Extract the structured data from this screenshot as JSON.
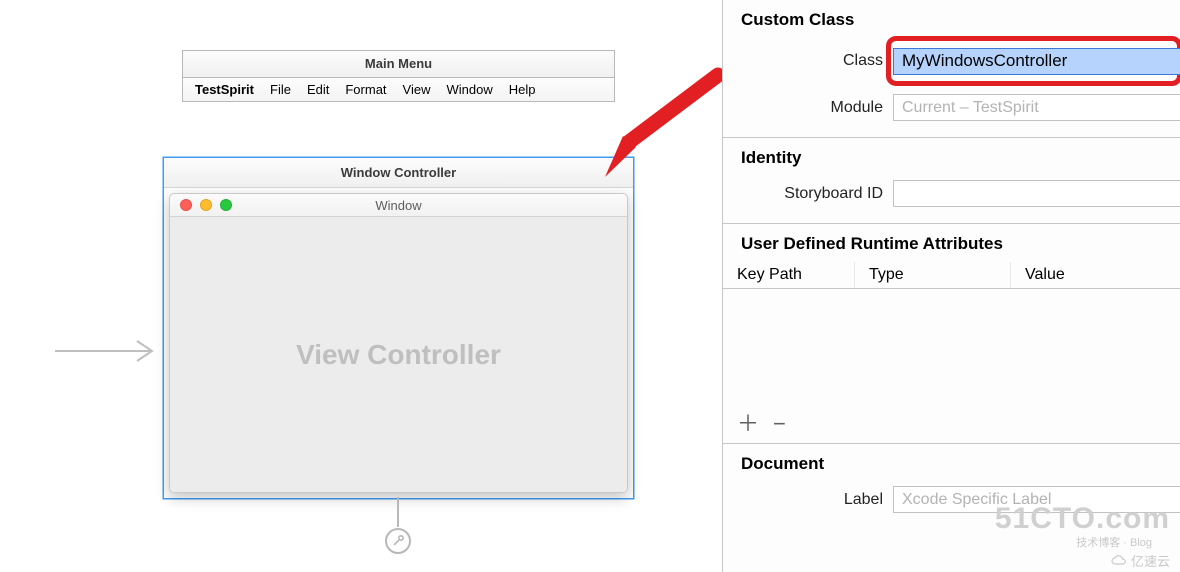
{
  "canvas": {
    "mainMenu": {
      "sceneTitle": "Main Menu",
      "items": [
        "TestSpirit",
        "File",
        "Edit",
        "Format",
        "View",
        "Window",
        "Help"
      ]
    },
    "windowController": {
      "sceneTitle": "Window Controller",
      "windowTitle": "Window",
      "contentLabel": "View Controller"
    }
  },
  "inspector": {
    "customClass": {
      "title": "Custom Class",
      "classLabel": "Class",
      "classValue": "MyWindowsController",
      "moduleLabel": "Module",
      "modulePlaceholder": "Current – TestSpirit"
    },
    "identity": {
      "title": "Identity",
      "storyboardIdLabel": "Storyboard ID",
      "storyboardIdValue": ""
    },
    "udra": {
      "title": "User Defined Runtime Attributes",
      "col1": "Key Path",
      "col2": "Type",
      "col3": "Value"
    },
    "document": {
      "title": "Document",
      "labelLabel": "Label",
      "labelPlaceholder": "Xcode Specific Label"
    }
  },
  "watermark": {
    "w1": "51CTO.com",
    "w1b": "技术博客 · Blog",
    "w2": "亿速云"
  }
}
